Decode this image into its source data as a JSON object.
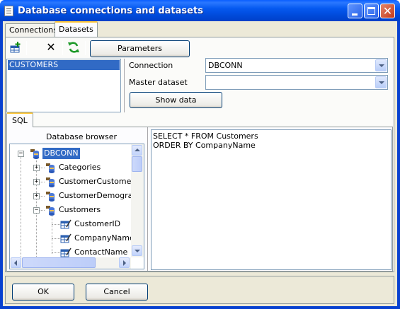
{
  "window": {
    "title": "Database connections and datasets",
    "min_icon": "minimize-icon",
    "max_icon": "maximize-icon",
    "close_icon": "close-icon",
    "close_glyph": "✕"
  },
  "tabs": [
    {
      "label": "Connections",
      "active": false
    },
    {
      "label": "Datasets",
      "active": true
    }
  ],
  "toolbar": {
    "add_icon": "add-dataset-icon",
    "delete_icon": "delete-icon",
    "delete_glyph": "✕",
    "refresh_icon": "refresh-icon",
    "parameters_label": "Parameters"
  },
  "datasets": {
    "items": [
      "CUSTOMERS"
    ],
    "selected": "CUSTOMERS"
  },
  "props": {
    "connection_label": "Connection",
    "connection_value": "DBCONN",
    "master_label": "Master dataset",
    "master_value": "",
    "show_data_label": "Show data"
  },
  "sql_tab": {
    "label": "SQL"
  },
  "browser": {
    "title": "Database browser",
    "nodes": [
      {
        "label": "DBCONN",
        "kind": "database",
        "expander": "−",
        "level": 0,
        "selected": true
      },
      {
        "label": "Categories",
        "kind": "table",
        "expander": "+",
        "level": 1
      },
      {
        "label": "CustomerCustomerDe",
        "kind": "table",
        "expander": "+",
        "level": 1
      },
      {
        "label": "CustomerDemograph",
        "kind": "table",
        "expander": "+",
        "level": 1
      },
      {
        "label": "Customers",
        "kind": "table",
        "expander": "−",
        "level": 1
      },
      {
        "label": "CustomerID",
        "kind": "field",
        "expander": "",
        "level": 2
      },
      {
        "label": "CompanyName",
        "kind": "field",
        "expander": "",
        "level": 2
      },
      {
        "label": "ContactName",
        "kind": "field",
        "expander": "",
        "level": 2
      }
    ]
  },
  "sql": {
    "lines": [
      "SELECT * FROM Customers",
      "ORDER BY CompanyName"
    ]
  },
  "footer": {
    "ok_label": "OK",
    "cancel_label": "Cancel"
  },
  "colors": {
    "titlebar": "#0a5fff",
    "dialog_bg": "#ece9d8",
    "selection": "#316ac5",
    "tab_highlight": "#ffc83c"
  }
}
